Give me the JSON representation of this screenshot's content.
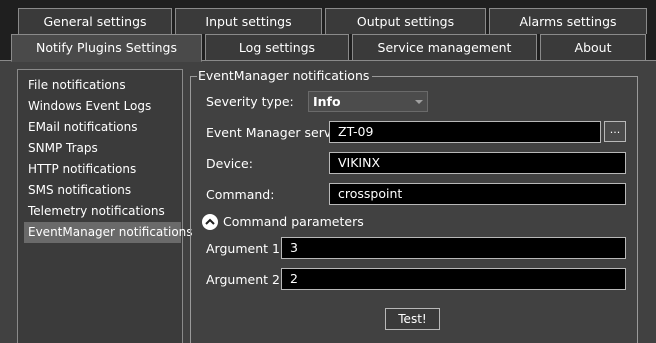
{
  "tabs_row1": [
    {
      "label": "General settings"
    },
    {
      "label": "Input settings"
    },
    {
      "label": "Output settings"
    },
    {
      "label": "Alarms settings"
    }
  ],
  "tabs_row2": [
    {
      "label": "Notify Plugins Settings",
      "active": true
    },
    {
      "label": "Log settings"
    },
    {
      "label": "Service management"
    },
    {
      "label": "About"
    }
  ],
  "sidebar": {
    "items": [
      {
        "label": "File notifications"
      },
      {
        "label": "Windows Event Logs"
      },
      {
        "label": "EMail notifications"
      },
      {
        "label": "SNMP Traps"
      },
      {
        "label": "HTTP notifications"
      },
      {
        "label": "SMS notifications"
      },
      {
        "label": "Telemetry notifications"
      },
      {
        "label": "EventManager notifications",
        "selected": true
      }
    ]
  },
  "group": {
    "title": "EventManager notifications",
    "severity_label": "Severity type:",
    "severity_value": "Info",
    "server_label": "Event Manager server:",
    "server_value": "ZT-09",
    "browse_label": "...",
    "device_label": "Device:",
    "device_value": "VIKINX",
    "command_label": "Command:",
    "command_value": "crosspoint",
    "params_label": "Command parameters",
    "arg1_label": "Argument 1:",
    "arg1_value": "3",
    "arg2_label": "Argument 2:",
    "arg2_value": "2",
    "test_label": "Test!"
  },
  "colors": {
    "background": "#414141",
    "field": "#000000",
    "selected": "#6a6a6a"
  }
}
